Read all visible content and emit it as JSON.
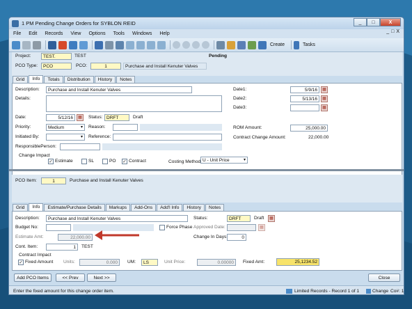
{
  "window": {
    "title": "1 PM Pending Change Orders for SYBLON REID",
    "min": "_",
    "max": "□",
    "close": "X"
  },
  "menu": [
    "File",
    "Edit",
    "Records",
    "View",
    "Options",
    "Tools",
    "Windows",
    "Help"
  ],
  "mdi": {
    "min": "_",
    "restore": "□",
    "close": "X"
  },
  "toolbar": {
    "create": "Create",
    "tasks": "Tasks"
  },
  "header": {
    "project_label": "Project:",
    "project_code": "TEST.",
    "project_name": "TEST",
    "status": "Pending",
    "pco_type_label": "PCO Type:",
    "pco_type": "PCO",
    "pco_label": "PCO:",
    "pco_num": "1",
    "pco_desc": "Purchase and Install Kenuter Valves"
  },
  "tabs1": [
    "Grid",
    "Info",
    "Totals",
    "Distribution",
    "History",
    "Notes"
  ],
  "info": {
    "description_label": "Description:",
    "description": "Purchase and Install Kenuter Valves",
    "details_label": "Details:",
    "date_label": "Date:",
    "date": "5/12/16",
    "status_label": "Status:",
    "status_code": "DRFT",
    "status_text": "Draft",
    "priority_label": "Priority:",
    "priority": "Medium",
    "reason_label": "Reason:",
    "initiated_label": "Initiated By:",
    "reference_label": "Reference:",
    "responsible_label": "ResponsiblePerson:",
    "change_impact_label": "Change Impact",
    "estimate_label": "Estimate",
    "sl_label": "SL",
    "po_label": "PO",
    "contract_label": "Contract",
    "costing_label": "Costing Method",
    "costing_value": "U - Unit Price",
    "date1_label": "Date1:",
    "date1": "5/9/16",
    "date2_label": "Date2:",
    "date2": "5/13/16",
    "date3_label": "Date3:",
    "rom_label": "ROM Amount:",
    "rom": "25,000.00",
    "ccamount_label": "Contract Change Amount:",
    "ccamount": "22,000.00"
  },
  "item": {
    "label": "PCO Item:",
    "num": "1",
    "desc": "Purchase and Install Kenuter Valves"
  },
  "tabs2": [
    "Grid",
    "Info",
    "Estimate/Purchase Details",
    "Markups",
    "Add-Ons",
    "Add'l Info",
    "History",
    "Notes"
  ],
  "item_info": {
    "description_label": "Description:",
    "description": "Purchase and Install Kenuter Valves",
    "status_label": "Status:",
    "status_code": "DRFT",
    "status_text": "Draft",
    "budget_label": "Budget No:",
    "force_label": "Force Phase",
    "approved_label": "Approved Date:",
    "estimate_label": "Estimate Amt:",
    "estimate": "22,000.00",
    "change_days_label": "Change In Days:",
    "change_days": "0",
    "cont_item_label": "Cont. Item:",
    "cont_item": "1",
    "cont_item_name": "TEST",
    "contract_impact_label": "Contract Impact",
    "fixed_label": "Fixed Amount",
    "units_label": "Units:",
    "units": "0.000",
    "um_label": "UM:",
    "um": "LS",
    "unit_price_label": "Unit Price:",
    "unit_price": "0.00000",
    "fixed_amt_label": "Fixed Amt:",
    "fixed_amt": "25,1234.52"
  },
  "buttons": {
    "add": "Add PCO Items",
    "prev": "<< Prev",
    "next": "Next >>",
    "close": "Close"
  },
  "status": {
    "hint": "Enter the fixed amount for this change order item.",
    "records": "Limited Records - Record 1 of 1",
    "change": "Change",
    "co": "Co#: 1"
  },
  "colors": {
    "arrow": "#c0392b",
    "required": "#fff9c4",
    "fixed_highlight": "#f7e36a"
  }
}
